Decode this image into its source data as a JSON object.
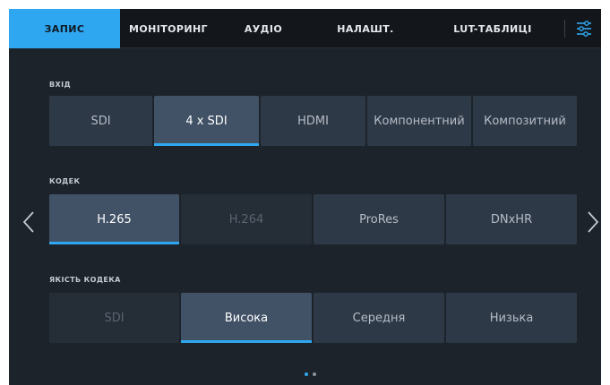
{
  "tabs": [
    {
      "label": "ЗАПИС",
      "active": true
    },
    {
      "label": "МОНІТОРИНГ",
      "active": false
    },
    {
      "label": "АУДІО",
      "active": false
    },
    {
      "label": "НАЛАШТ.",
      "active": false
    },
    {
      "label": "LUT-ТАБЛИЦІ",
      "active": false
    }
  ],
  "settings_icon": "sliders-icon",
  "sections": {
    "input": {
      "label": "ВХІД",
      "options": [
        "SDI",
        "4 x SDI",
        "HDMI",
        "Компонентний",
        "Композитний"
      ],
      "selected": "4 x SDI"
    },
    "codec": {
      "label": "КОДЕК",
      "options": [
        "H.265",
        "H.264",
        "ProRes",
        "DNxHR"
      ],
      "selected": "H.265",
      "disabled": [
        "H.264"
      ]
    },
    "quality": {
      "label": "ЯКІСТЬ КОДЕКА",
      "options": [
        "SDI",
        "Висока",
        "Середня",
        "Низька"
      ],
      "selected": "Висока",
      "disabled": [
        "SDI"
      ]
    }
  },
  "navigation": {
    "prev_icon": "chevron-left-icon",
    "next_icon": "chevron-right-icon"
  },
  "pagination": {
    "pages": 2,
    "current": 1
  },
  "colors": {
    "accent": "#2fa7f0",
    "background": "#1d232b",
    "tab_bar": "#13171c"
  }
}
